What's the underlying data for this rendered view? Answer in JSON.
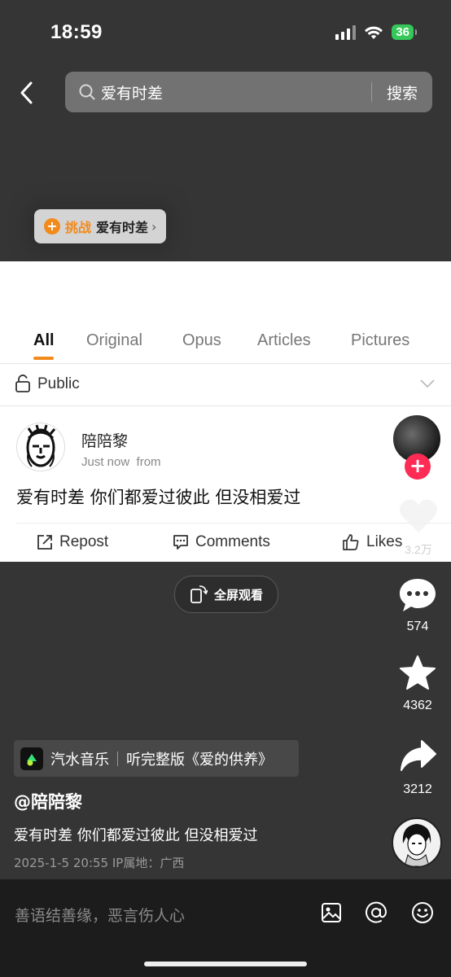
{
  "status_bar": {
    "time": "18:59",
    "battery": "36"
  },
  "search": {
    "query": "爱有时差",
    "button_label": "搜索"
  },
  "challenge_chip": {
    "label": "挑战",
    "text": "爱有时差"
  },
  "tabs": [
    "All",
    "Original",
    "Opus",
    "Articles",
    "Pictures"
  ],
  "visibility": {
    "label": "Public"
  },
  "post": {
    "username": "陪陪黎",
    "time": "Just now",
    "from": "from",
    "text": "爱有时差 你们都爱过彼此 但没相爱过",
    "actions": {
      "repost": "Repost",
      "comments": "Comments",
      "likes": "Likes"
    }
  },
  "fullscreen_label": "全屏观看",
  "rail": {
    "likes_count": "3.2万",
    "comments_count": "574",
    "favorites_count": "4362",
    "shares_count": "3212"
  },
  "music": {
    "app": "汽水音乐",
    "song": "听完整版《爱的供养》"
  },
  "video": {
    "author": "@陪陪黎",
    "description": "爱有时差 你们都爱过彼此 但没相爱过",
    "date_location": "2025-1-5 20:55  IP属地：广西"
  },
  "comment_bar": {
    "placeholder": "善语结善缘，恶言伤人心"
  }
}
